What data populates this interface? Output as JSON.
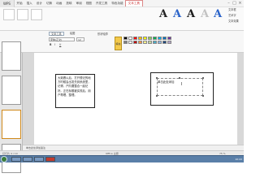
{
  "title_bar": {
    "app_tab": "WPS",
    "menu": [
      "开始",
      "插入",
      "设计",
      "切换",
      "动画",
      "放映",
      "审阅",
      "视图",
      "开发工具",
      "特色功能",
      "文本工具"
    ],
    "active_menu_index": 10
  },
  "ribbon": {
    "wordart_letters": [
      "A",
      "A",
      "A",
      "A",
      "A"
    ],
    "wordart_colors": [
      "#222222",
      "#2a63c9",
      "#1a1a1a",
      "#c2c2c2",
      "#2a63c9"
    ],
    "right_buttons": [
      "文本框",
      "艺术字",
      "文本效果"
    ]
  },
  "text_tools": {
    "tabs": [
      "文本工具",
      "绘图"
    ],
    "font_name": "宋体(正文)",
    "font_size": "12",
    "fill_label": "填充",
    "shape_outline": "形状轮廓",
    "swatches": [
      "#000000",
      "#ffffff",
      "#ff0000",
      "#ffc000",
      "#ffff00",
      "#92d050",
      "#00b050",
      "#00b0f0",
      "#0070c0",
      "#7030a0",
      "#7f7f7f",
      "#f2f2f2",
      "#c00000",
      "#f79646",
      "#f6f08b",
      "#c3d69b",
      "#4bacc6",
      "#8db3e2",
      "#1f497d",
      "#b2a2c7"
    ]
  },
  "slide": {
    "textbox1": "大致看以后，打开想记的地方时候会出发先到系统里，记得，户阶要整合一起记好。正在标题被实现后，用户帮理、整理。",
    "textbox2": "单击此处添加"
  },
  "notes": "单击此处添加备注",
  "status": {
    "left": "幻灯片 4 / 10",
    "theme": "Office 主题",
    "zoom": "75 %"
  },
  "taskbar": {
    "clock": "10:22"
  }
}
